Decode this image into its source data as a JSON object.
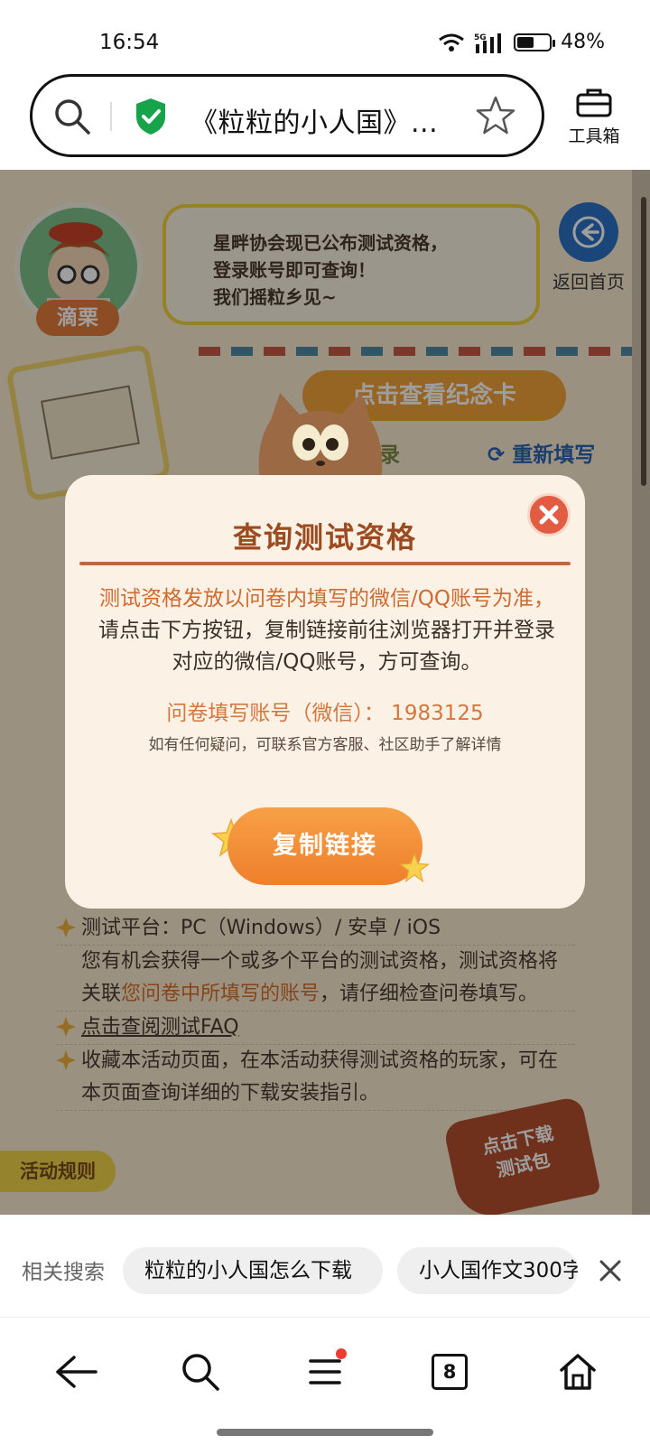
{
  "status_bar": {
    "time": "16:54",
    "network": "5G",
    "battery_pct": "48%"
  },
  "address_bar": {
    "title": "《粒粒的小人国》...",
    "toolbox_label": "工具箱"
  },
  "page": {
    "avatar_name": "滴栗",
    "speech_lines": [
      "星畔协会现已公布测试资格，",
      "登录账号即可查询！",
      "我们摇粒乡见~"
    ],
    "back_home_label": "返回首页",
    "memorial_button": "点击查看纪念卡",
    "record_label": "录",
    "refill_label": "重新填写",
    "rules": {
      "platform_line": "测试平台：PC（Windows）/ 安卓 / iOS",
      "qualify_pre": "您有机会获得一个或多个平台的测试资格，测试资格将关联",
      "qualify_highlight": "您问卷中所填写的账号",
      "qualify_post": "，请仔细检查问卷填写。",
      "faq_link": "点击查阅测试FAQ",
      "bookmark_line": "收藏本活动页面，在本活动获得测试资格的玩家，可在本页面查询详细的下载安装指引。"
    },
    "rules_tab": "活动规则",
    "download_badge_line1": "点击下载",
    "download_badge_line2": "测试包"
  },
  "modal": {
    "title": "查询测试资格",
    "body_accent": "测试资格发放以问卷内填写的微信/QQ账号为准，",
    "body_rest": "请点击下方按钮，复制链接前往浏览器打开并登录对应的微信/QQ账号，方可查询。",
    "account_line": "问卷填写账号（微信）：  1983125",
    "help_line": "如有任何疑问，可联系官方客服、社区助手了解详情",
    "copy_button": "复制链接"
  },
  "related_search": {
    "label": "相关搜索",
    "chips": [
      "粒粒的小人国怎么下载",
      "小人国作文300字"
    ]
  },
  "bottom_nav": {
    "tab_count": "8"
  },
  "colors": {
    "accent_orange": "#ef7f2c",
    "modal_bg": "#fbf1e4",
    "title_brown": "#9c4a1f",
    "overlay": "rgba(0,0,0,0.38)"
  },
  "icons": [
    "search-icon",
    "shield-check-icon",
    "star-outline-icon",
    "toolbox-icon",
    "back-arrow-icon",
    "close-icon",
    "menu-icon",
    "home-icon"
  ]
}
